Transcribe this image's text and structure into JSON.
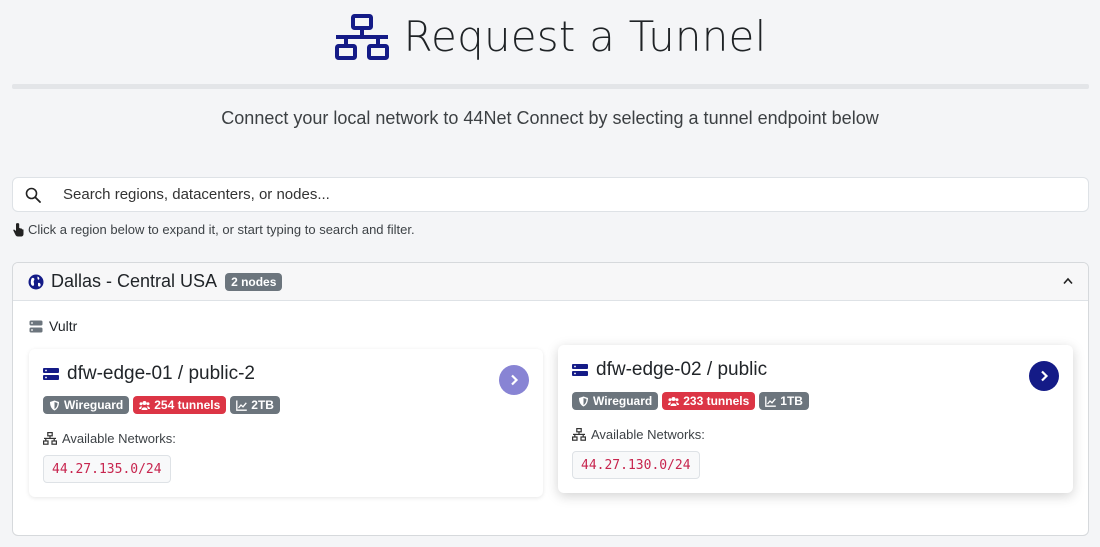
{
  "header": {
    "title": "Request a Tunnel",
    "icon": "network-icon",
    "subtitle": "Connect your local network to 44Net Connect by selecting a tunnel endpoint below"
  },
  "search": {
    "placeholder": "Search regions, datacenters, or nodes...",
    "value": ""
  },
  "hint": {
    "text": "Click a region below to expand it, or start typing to search and filter."
  },
  "region": {
    "name": "Dallas - Central USA",
    "node_count": "2 nodes",
    "expanded": true,
    "provider": "Vultr",
    "nodes": [
      {
        "name": "dfw-edge-01 / public-2",
        "protocol": "Wireguard",
        "tunnels": "254 tunnels",
        "bandwidth": "2TB",
        "networks_label": "Available Networks:",
        "networks": [
          "44.27.135.0/24"
        ]
      },
      {
        "name": "dfw-edge-02 / public",
        "protocol": "Wireguard",
        "tunnels": "233 tunnels",
        "bandwidth": "1TB",
        "networks_label": "Available Networks:",
        "networks": [
          "44.27.130.0/24"
        ]
      }
    ]
  },
  "colors": {
    "accent": "#141b87",
    "accent_muted": "#8884d4",
    "badge_gray": "#6c757d",
    "badge_red": "#dc3545",
    "code": "#c7254e"
  }
}
